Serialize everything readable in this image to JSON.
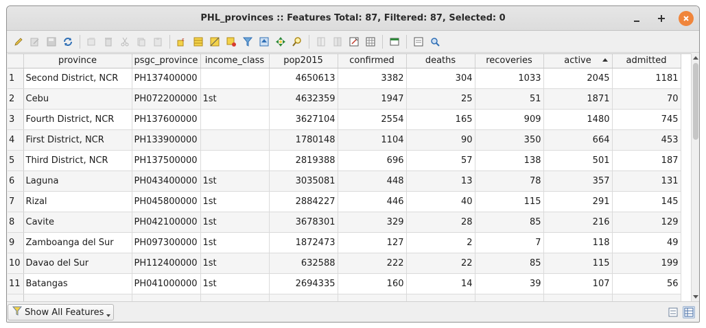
{
  "window": {
    "title": "PHL_provinces :: Features Total: 87, Filtered: 87, Selected: 0",
    "minimize_icon": "minimize-icon",
    "maximize_icon": "maximize-icon",
    "close_icon": "close-icon",
    "close_color": "#f0853b"
  },
  "toolbar": {
    "icons": [
      "pencil-icon",
      "toggle-multi-edit-icon",
      "save-edits-icon",
      "reload-icon",
      "add-feature-icon",
      "delete-feature-icon",
      "cut-icon",
      "copy-icon",
      "paste-icon",
      "select-by-expression-icon",
      "select-all-icon",
      "invert-selection-icon",
      "deselect-all-icon",
      "filter-selected-icon",
      "move-selection-top-icon",
      "pan-to-selected-icon",
      "zoom-to-selected-icon",
      "new-field-icon",
      "delete-field-icon",
      "field-calculator-icon",
      "conditional-formatting-icon",
      "dock-table-icon",
      "form-view-icon",
      "actions-icon"
    ]
  },
  "table": {
    "columns": [
      "province",
      "psgc_province",
      "income_class",
      "pop2015",
      "confirmed",
      "deaths",
      "recoveries",
      "active",
      "admitted"
    ],
    "sorted_column": "active",
    "rows": [
      {
        "n": "1",
        "province": "Second District, NCR",
        "psgc": "PH137400000",
        "income": "",
        "pop": "4650613",
        "confirmed": "3382",
        "deaths": "304",
        "recoveries": "1033",
        "active": "2045",
        "admitted": "1181"
      },
      {
        "n": "2",
        "province": "Cebu",
        "psgc": "PH072200000",
        "income": "1st",
        "pop": "4632359",
        "confirmed": "1947",
        "deaths": "25",
        "recoveries": "51",
        "active": "1871",
        "admitted": "70"
      },
      {
        "n": "3",
        "province": "Fourth District, NCR",
        "psgc": "PH137600000",
        "income": "",
        "pop": "3627104",
        "confirmed": "2554",
        "deaths": "165",
        "recoveries": "909",
        "active": "1480",
        "admitted": "745"
      },
      {
        "n": "4",
        "province": "First District, NCR",
        "psgc": "PH133900000",
        "income": "",
        "pop": "1780148",
        "confirmed": "1104",
        "deaths": "90",
        "recoveries": "350",
        "active": "664",
        "admitted": "453"
      },
      {
        "n": "5",
        "province": "Third District, NCR",
        "psgc": "PH137500000",
        "income": "",
        "pop": "2819388",
        "confirmed": "696",
        "deaths": "57",
        "recoveries": "138",
        "active": "501",
        "admitted": "187"
      },
      {
        "n": "6",
        "province": "Laguna",
        "psgc": "PH043400000",
        "income": "1st",
        "pop": "3035081",
        "confirmed": "448",
        "deaths": "13",
        "recoveries": "78",
        "active": "357",
        "admitted": "131"
      },
      {
        "n": "7",
        "province": "Rizal",
        "psgc": "PH045800000",
        "income": "1st",
        "pop": "2884227",
        "confirmed": "446",
        "deaths": "40",
        "recoveries": "115",
        "active": "291",
        "admitted": "145"
      },
      {
        "n": "8",
        "province": "Cavite",
        "psgc": "PH042100000",
        "income": "1st",
        "pop": "3678301",
        "confirmed": "329",
        "deaths": "28",
        "recoveries": "85",
        "active": "216",
        "admitted": "129"
      },
      {
        "n": "9",
        "province": "Zamboanga del Sur",
        "psgc": "PH097300000",
        "income": "1st",
        "pop": "1872473",
        "confirmed": "127",
        "deaths": "2",
        "recoveries": "7",
        "active": "118",
        "admitted": "49"
      },
      {
        "n": "10",
        "province": "Davao del Sur",
        "psgc": "PH112400000",
        "income": "1st",
        "pop": "632588",
        "confirmed": "222",
        "deaths": "22",
        "recoveries": "85",
        "active": "115",
        "admitted": "199"
      },
      {
        "n": "11",
        "province": "Batangas",
        "psgc": "PH041000000",
        "income": "1st",
        "pop": "2694335",
        "confirmed": "160",
        "deaths": "14",
        "recoveries": "39",
        "active": "107",
        "admitted": "56"
      }
    ]
  },
  "bottom": {
    "filter_label": "Show All Features",
    "filter_icon": "filter-icon",
    "view_icons": [
      "form-view-icon",
      "table-view-icon"
    ]
  }
}
